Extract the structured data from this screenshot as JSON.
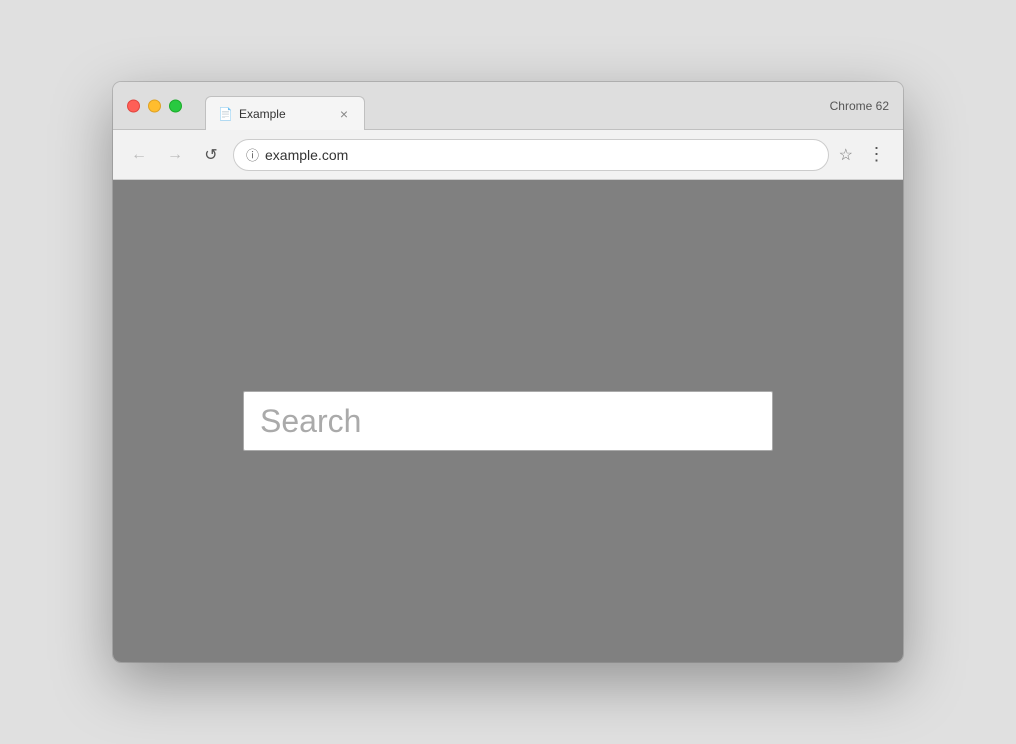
{
  "browser": {
    "chrome_version": "Chrome 62",
    "window_controls": {
      "close_label": "close",
      "minimize_label": "minimize",
      "maximize_label": "maximize"
    },
    "tab": {
      "icon": "📄",
      "title": "Example",
      "close_symbol": "×"
    },
    "toolbar": {
      "back_symbol": "←",
      "forward_symbol": "→",
      "reload_symbol": "↺",
      "address": "example.com",
      "security_symbol": "ⓘ",
      "bookmark_symbol": "☆",
      "menu_symbol": "⋮"
    },
    "page": {
      "background_color": "#808080",
      "search_placeholder": "Search"
    }
  }
}
